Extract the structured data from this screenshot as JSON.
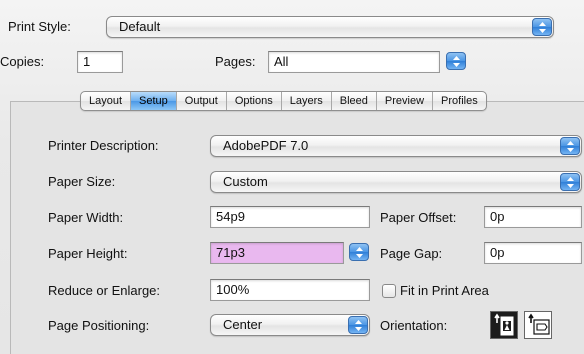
{
  "print_style": {
    "label": "Print Style:",
    "value": "Default"
  },
  "copies": {
    "label": "Copies:",
    "value": "1"
  },
  "pages": {
    "label": "Pages:",
    "value": "All"
  },
  "tabs": [
    {
      "label": "Layout",
      "active": false
    },
    {
      "label": "Setup",
      "active": true
    },
    {
      "label": "Output",
      "active": false
    },
    {
      "label": "Options",
      "active": false
    },
    {
      "label": "Layers",
      "active": false
    },
    {
      "label": "Bleed",
      "active": false
    },
    {
      "label": "Preview",
      "active": false
    },
    {
      "label": "Profiles",
      "active": false
    }
  ],
  "setup": {
    "printer_description": {
      "label": "Printer Description:",
      "value": "AdobePDF 7.0"
    },
    "paper_size": {
      "label": "Paper Size:",
      "value": "Custom"
    },
    "paper_width": {
      "label": "Paper Width:",
      "value": "54p9"
    },
    "paper_offset": {
      "label": "Paper Offset:",
      "value": "0p"
    },
    "paper_height": {
      "label": "Paper Height:",
      "value": "71p3"
    },
    "page_gap": {
      "label": "Page Gap:",
      "value": "0p"
    },
    "reduce_enlarge": {
      "label": "Reduce or Enlarge:",
      "value": "100%"
    },
    "fit_in_print_area": {
      "label": "Fit in Print Area",
      "checked": false
    },
    "page_positioning": {
      "label": "Page Positioning:",
      "value": "Center"
    },
    "orientation": {
      "label": "Orientation:",
      "selected": "portrait"
    }
  },
  "colors": {
    "accent": "#4a95e4",
    "selection": "#e9b8ef"
  }
}
